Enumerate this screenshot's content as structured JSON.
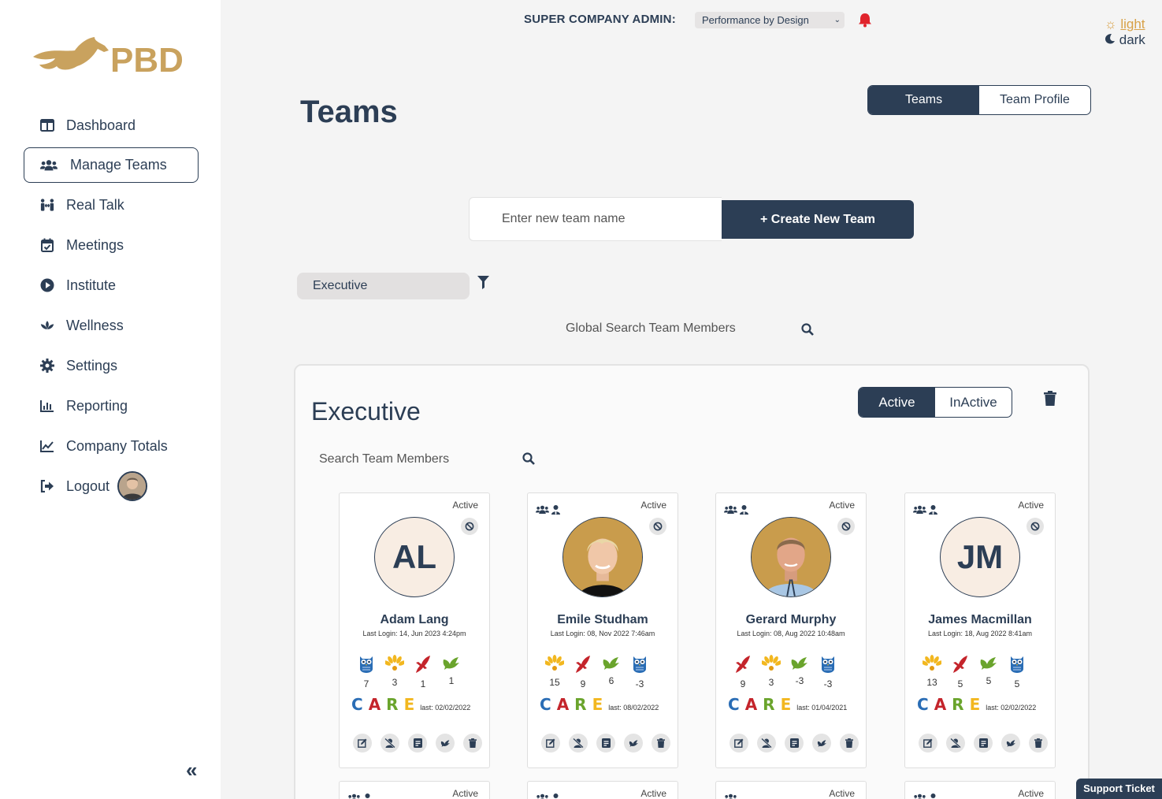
{
  "sidebar": {
    "logo_text": "PBD",
    "items": [
      {
        "label": "Dashboard",
        "icon": "dashboard-icon"
      },
      {
        "label": "Manage Teams",
        "icon": "users-icon"
      },
      {
        "label": "Real Talk",
        "icon": "people-arrows-icon"
      },
      {
        "label": "Meetings",
        "icon": "calendar-check-icon"
      },
      {
        "label": "Institute",
        "icon": "play-circle-icon"
      },
      {
        "label": "Wellness",
        "icon": "lotus-icon"
      },
      {
        "label": "Settings",
        "icon": "gear-icon"
      },
      {
        "label": "Reporting",
        "icon": "bar-chart-icon"
      },
      {
        "label": "Company Totals",
        "icon": "line-chart-icon"
      },
      {
        "label": "Logout",
        "icon": "logout-icon"
      }
    ],
    "active_index": 1,
    "collapse_label": "«"
  },
  "topbar": {
    "admin_label": "SUPER COMPANY ADMIN:",
    "company": "Performance by Design",
    "theme_light": "light",
    "theme_dark": "dark"
  },
  "page": {
    "title": "Teams",
    "tabs": [
      "Teams",
      "Team Profile"
    ],
    "new_team_placeholder": "Enter new team name",
    "create_label": "+ Create New Team",
    "selected_team": "Executive",
    "global_search_placeholder": "Global Search Team Members"
  },
  "panel": {
    "title": "Executive",
    "status_tabs": [
      "Active",
      "InActive"
    ],
    "search_placeholder": "Search Team Members"
  },
  "colors": {
    "navy": "#2c3e55",
    "gold": "#d8a148",
    "owl": "#2a6db5",
    "peacock": "#f2b71f",
    "eagle": "#c4242b",
    "dove": "#6aa42c"
  },
  "cards": [
    {
      "status": "Active",
      "initials": "AL",
      "name": "Adam Lang",
      "login": "Last Login: 14, Jun 2023 4:24pm",
      "roles": false,
      "animals": [
        {
          "type": "owl",
          "n": "7"
        },
        {
          "type": "peacock",
          "n": "3"
        },
        {
          "type": "eagle",
          "n": "1"
        },
        {
          "type": "dove",
          "n": "1"
        }
      ],
      "care_last": "last: 02/02/2022"
    },
    {
      "status": "Active",
      "initials": "",
      "name": "Emile Studham",
      "login": "Last Login: 08, Nov 2022 7:46am",
      "roles": true,
      "animals": [
        {
          "type": "peacock",
          "n": "15"
        },
        {
          "type": "eagle",
          "n": "9"
        },
        {
          "type": "dove",
          "n": "6"
        },
        {
          "type": "owl",
          "n": "-3"
        }
      ],
      "care_last": "last: 08/02/2022"
    },
    {
      "status": "Active",
      "initials": "",
      "name": "Gerard Murphy",
      "login": "Last Login: 08, Aug 2022 10:48am",
      "roles": true,
      "animals": [
        {
          "type": "eagle",
          "n": "9"
        },
        {
          "type": "peacock",
          "n": "3"
        },
        {
          "type": "dove",
          "n": "-3"
        },
        {
          "type": "owl",
          "n": "-3"
        }
      ],
      "care_last": "last: 01/04/2021"
    },
    {
      "status": "Active",
      "initials": "JM",
      "name": "James Macmillan",
      "login": "Last Login: 18, Aug 2022 8:41am",
      "roles": true,
      "animals": [
        {
          "type": "peacock",
          "n": "13"
        },
        {
          "type": "eagle",
          "n": "5"
        },
        {
          "type": "dove",
          "n": "5"
        },
        {
          "type": "owl",
          "n": "5"
        }
      ],
      "care_last": "last: 02/02/2022"
    }
  ],
  "peek_cards": [
    "Active",
    "Active",
    "Active",
    "Active"
  ],
  "care_letters": [
    "C",
    "A",
    "R",
    "E"
  ],
  "support_label": "Support Ticket"
}
